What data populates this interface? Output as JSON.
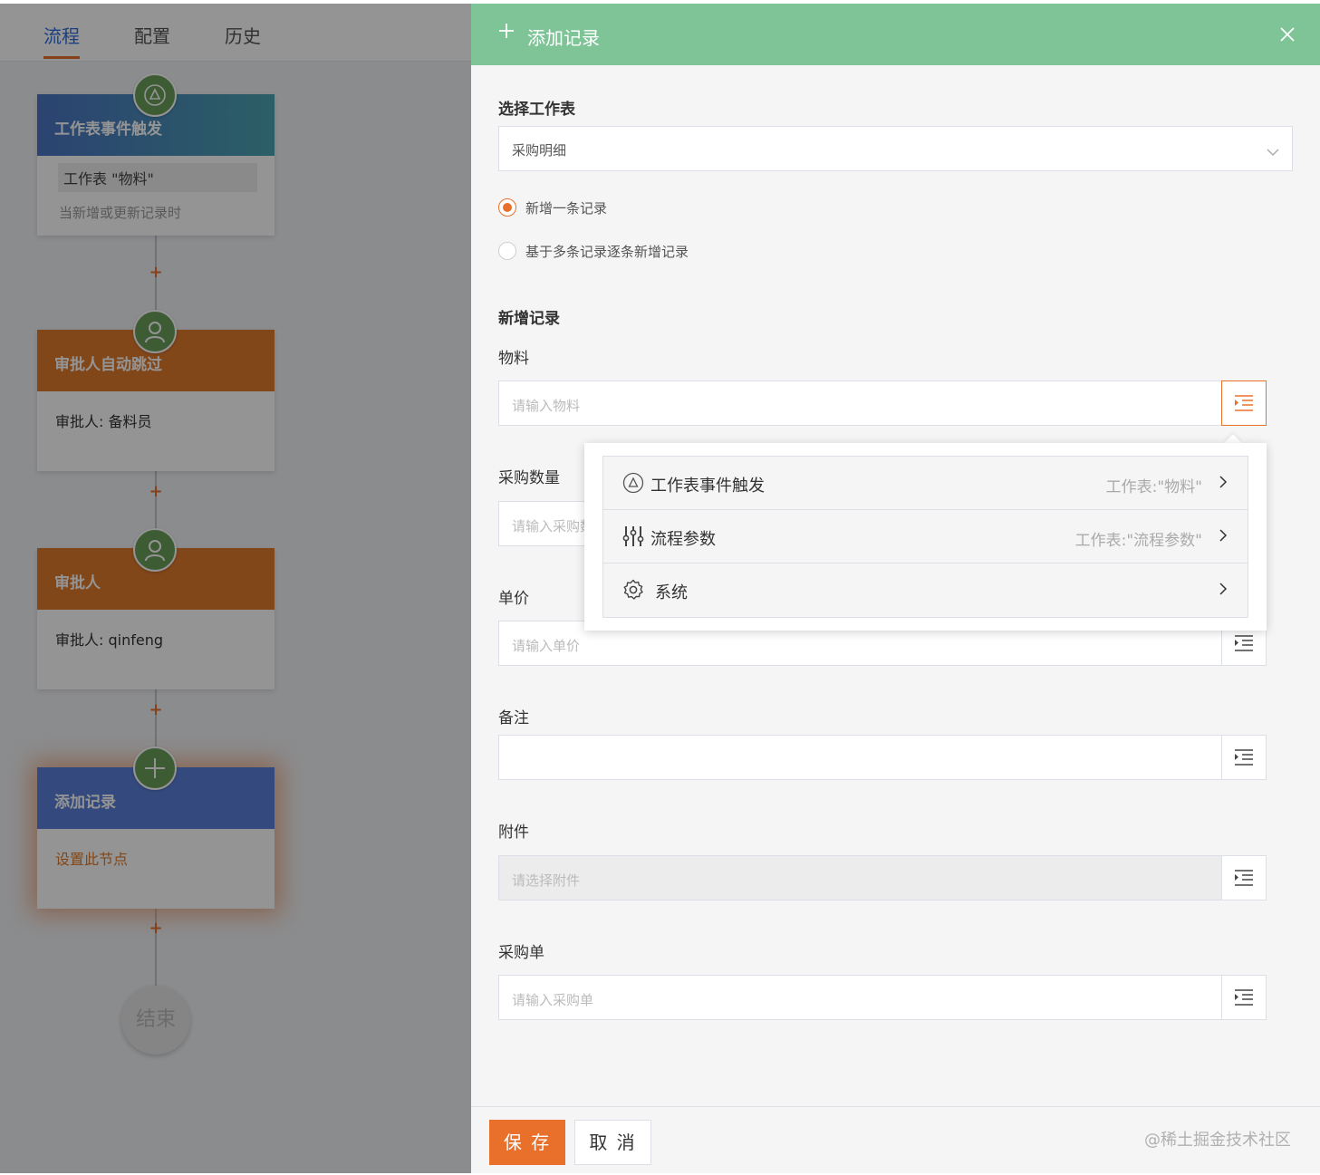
{
  "left_panel": {
    "tabs": [
      {
        "label": "流程",
        "active": true
      },
      {
        "label": "配置",
        "active": false
      },
      {
        "label": "历史",
        "active": false
      }
    ],
    "nodes": [
      {
        "title": "工作表事件触发",
        "line1": "工作表 \"物料\"",
        "line2": "当新增或更新记录时",
        "header_color": "#4aa4b0",
        "icon": "triangle-icon"
      },
      {
        "title": "审批人自动跳过",
        "line1": "审批人: 备料员",
        "header_color": "#e07a2c",
        "icon": "user-icon"
      },
      {
        "title": "审批人",
        "line1": "审批人: qinfeng",
        "header_color": "#e07a2c",
        "icon": "user-icon"
      },
      {
        "title": "添加记录",
        "line1": "设置此节点",
        "header_color": "#5a7fd8",
        "icon": "plus-icon"
      }
    ],
    "add_symbol": "+",
    "end_label": "结束"
  },
  "drawer": {
    "title": "添加记录",
    "title_icon": "plus-icon",
    "header_color": "#7ec497",
    "select_sheet_label": "选择工作表",
    "select_sheet_value": "采购明细",
    "radio_options": [
      {
        "label": "新增一条记录",
        "checked": true
      },
      {
        "label": "基于多条记录逐条新增记录",
        "checked": false
      }
    ],
    "section_title": "新增记录",
    "fields": [
      {
        "label": "物料",
        "placeholder": "请输入物料"
      },
      {
        "label": "采购数量",
        "placeholder": "请输入采购数量"
      },
      {
        "label": "单价",
        "placeholder": "请输入单价"
      },
      {
        "label": "备注",
        "placeholder": ""
      },
      {
        "label": "附件",
        "placeholder": "请选择附件"
      },
      {
        "label": "采购单",
        "placeholder": "请输入采购单"
      }
    ],
    "dropdown": {
      "items": [
        {
          "label": "工作表事件触发",
          "hint": "工作表:\"物料\"",
          "icon": "triangle-circle-icon"
        },
        {
          "label": "流程参数",
          "hint": "工作表:\"流程参数\"",
          "icon": "sliders-icon"
        },
        {
          "label": "系统",
          "hint": "",
          "icon": "gear-icon"
        }
      ]
    },
    "footer": {
      "save_label": "保 存",
      "cancel_label": "取 消",
      "watermark": "@稀土掘金技术社区"
    },
    "accent_color": "#e8702a"
  }
}
